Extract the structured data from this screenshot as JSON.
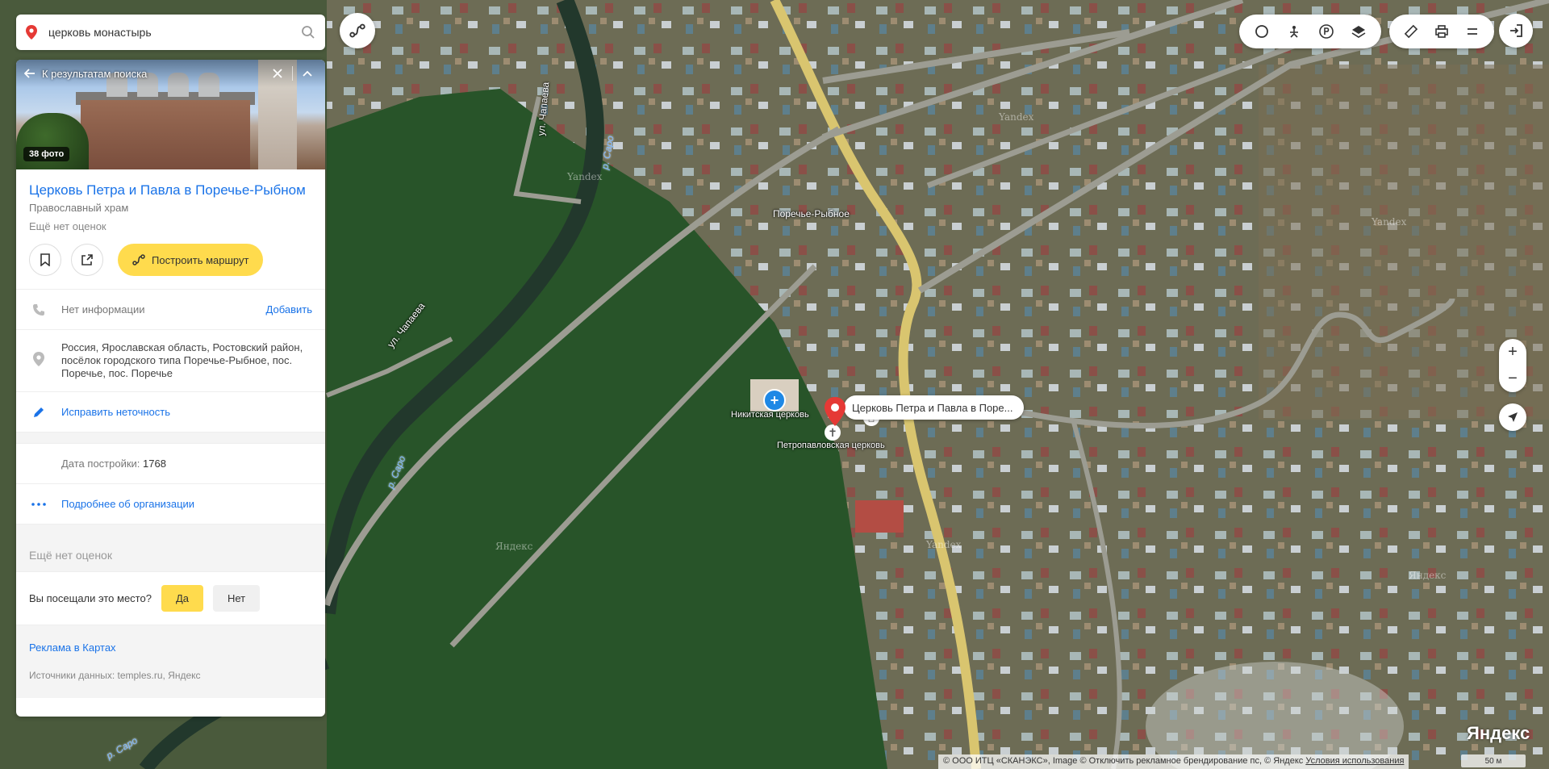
{
  "search": {
    "value": "церковь монастырь",
    "placeholder": ""
  },
  "panel": {
    "back_label": "К результатам поиска",
    "photo_count": "38 фото",
    "title": "Церковь Петра и Павла в Поречье-Рыбном",
    "category": "Православный храм",
    "rating": "Ещё нет оценок",
    "route_label": "Построить маршрут",
    "phone": {
      "text": "Нет информации",
      "action": "Добавить"
    },
    "address": "Россия, Ярославская область, Ростовский район, посёлок городского типа Поречье-Рыбное, пос. Поречье, пос. Поречье",
    "fix_label": "Исправить неточность",
    "built": {
      "label": "Дата постройки:",
      "value": "1768"
    },
    "more_label": "Подробнее об организации",
    "no_rating": "Ещё нет оценок",
    "visited": {
      "question": "Вы посещали это место?",
      "yes": "Да",
      "no": "Нет"
    },
    "ad_link": "Реклама в Картах",
    "sources": "Источники данных: temples.ru, Яндекс"
  },
  "map": {
    "labels": {
      "town": "Поречье-Рыбное",
      "street1": "ул. Чапаева",
      "street2": "ул. Чапаева",
      "river1": "р. Саро",
      "river2": "р. Саро",
      "river3": "р. Саро"
    },
    "watermarks": [
      "Yandex",
      "Yandex",
      "Yandex",
      "Яндекс",
      "Yandex",
      "Яндекс",
      "Yandex"
    ],
    "pois": {
      "nikitskaya": "Никитская церковь",
      "petropavlovskaya": "Петропавловская церковь",
      "callout": "Церковь Петра и Павла в Поре..."
    }
  },
  "zoom": {
    "in": "+",
    "out": "−"
  },
  "footer": {
    "copyright": "© ООО ИТЦ «СКАНЭКС», Image © Отключить рекламное брендирование пс, © Яндекс",
    "terms": "Условия использования",
    "logo": "Яндекс",
    "scale": "50 м"
  },
  "colors": {
    "accent": "#1a73e8",
    "yellow": "#ffdb4d",
    "pin_red": "#e53935"
  }
}
